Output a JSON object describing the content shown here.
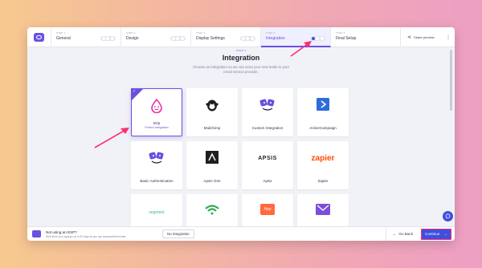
{
  "steps": [
    {
      "num": "STEP 1",
      "name": "General"
    },
    {
      "num": "STEP 2",
      "name": "Design"
    },
    {
      "num": "STEP 3",
      "name": "Display Settings"
    },
    {
      "num": "STEP 4",
      "name": "Integration"
    },
    {
      "num": "STEP 5",
      "name": "Final Setup"
    }
  ],
  "active_step": "Integration",
  "toolbar": {
    "share_label": "Share preview",
    "more_label": "⋮"
  },
  "page": {
    "step_label": "STEP 4",
    "title": "Integration",
    "description_line1": "Choose an integration so we can send your new leads to your",
    "description_line2": "email service provider."
  },
  "integrations": [
    {
      "name": "Drip",
      "sub": "Perfect integration",
      "icon": "drip-icon",
      "selected": true
    },
    {
      "name": "Mailchimp",
      "icon": "mailchimp-icon"
    },
    {
      "name": "Custom Integration",
      "icon": "custom-integration-icon"
    },
    {
      "name": "ActiveCampaign",
      "icon": "activecampaign-icon"
    },
    {
      "name": "Basic Authentication",
      "icon": "basic-auth-icon"
    },
    {
      "name": "Apsis One",
      "icon": "apsis-one-icon"
    },
    {
      "name": "Apsis",
      "icon": "apsis-icon",
      "logo_text": "APSIS"
    },
    {
      "name": "Zapier",
      "icon": "zapier-icon",
      "logo_text": "zapier"
    },
    {
      "name": "",
      "icon": "segment-icon",
      "logo_text": "segment"
    },
    {
      "name": "",
      "icon": "wifi-icon"
    },
    {
      "name": "",
      "icon": "hey-icon",
      "logo_text": "Hey"
    },
    {
      "name": "",
      "icon": "envelope-icon"
    }
  ],
  "bottom": {
    "title": "Not using an ESP?",
    "subtitle": "We'll store your signups up to 90 days so you can download them later.",
    "no_integration_label": "No Integration",
    "go_back_label": "Go Back",
    "continue_label": "Continue"
  },
  "colors": {
    "accent": "#6b4fe0",
    "primary_button": "#3f4fe0",
    "annotation": "#ff2d6f"
  }
}
